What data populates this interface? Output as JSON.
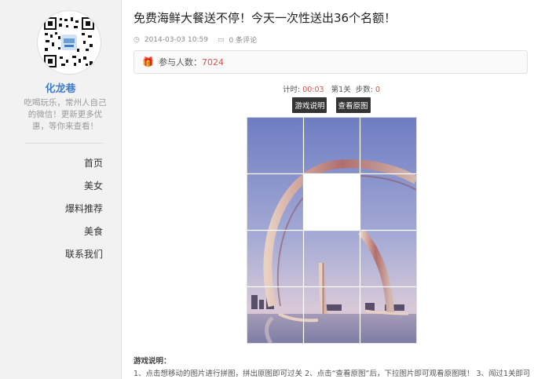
{
  "sidebar": {
    "site_name": "化龙巷",
    "description": "吃喝玩乐，常州人自己的微信！更新更多优惠，等你来查看！",
    "nav": [
      {
        "label": "首页"
      },
      {
        "label": "美女"
      },
      {
        "label": "爆料推荐"
      },
      {
        "label": "美食"
      },
      {
        "label": "联系我们"
      }
    ]
  },
  "post": {
    "title": "免费海鲜大餐送不停！今天一次性送出36个名额！",
    "date": "2014-03-03 10:59",
    "comments": "0 条评论",
    "participants_label": "参与人数：",
    "participants_count": "7024"
  },
  "game": {
    "timer_label": "计时:",
    "timer_value": "00:03",
    "level": "第1关",
    "steps_label": "步数:",
    "steps_value": "0",
    "btn_instructions": "游戏说明",
    "btn_original": "查看原图",
    "instructions_title": "游戏说明：",
    "instructions_text": "1、点击想移动的图片进行拼图，拼出原图即可过关 2、点击“查看原图”后，下拉图片即可观看原图哦！ 3、闯过1关即可"
  },
  "colors": {
    "accent": "#3d7cc9",
    "highlight": "#d9534f",
    "sky_top": "#6e7dc2",
    "sky_bottom": "#d9c9d8"
  },
  "icons": {
    "clock": "clock-icon",
    "comment": "comment-icon",
    "gift": "gift-icon"
  }
}
